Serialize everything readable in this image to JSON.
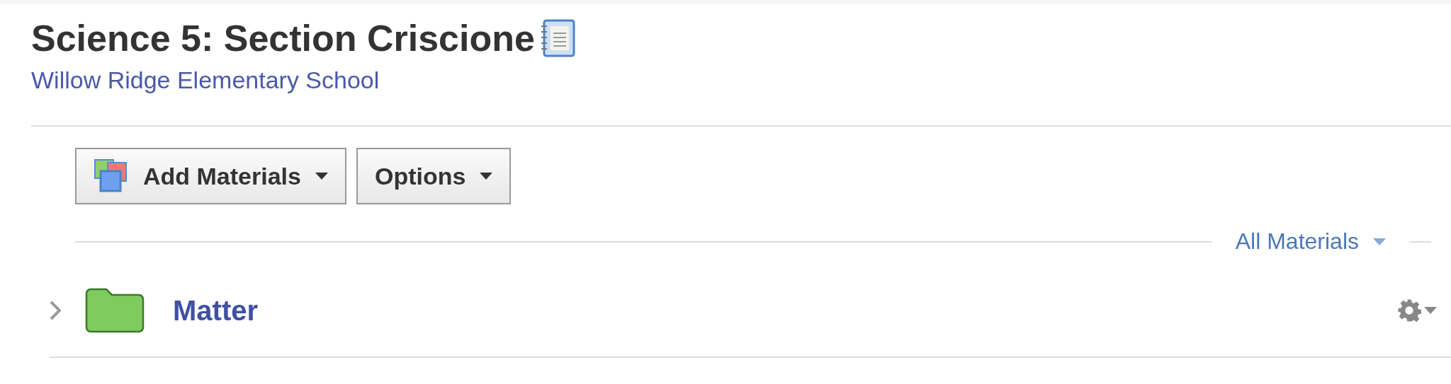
{
  "header": {
    "title": "Science 5: Section Criscione",
    "school": "Willow Ridge Elementary School"
  },
  "toolbar": {
    "buttons": [
      {
        "label": "Add Materials",
        "kind": "add"
      },
      {
        "label": "Options",
        "kind": "plain"
      }
    ]
  },
  "filter": {
    "label": "All Materials"
  },
  "materials": [
    {
      "name": "Matter",
      "kind": "folder",
      "expanded": false,
      "color": "#7ecb5e"
    }
  ]
}
